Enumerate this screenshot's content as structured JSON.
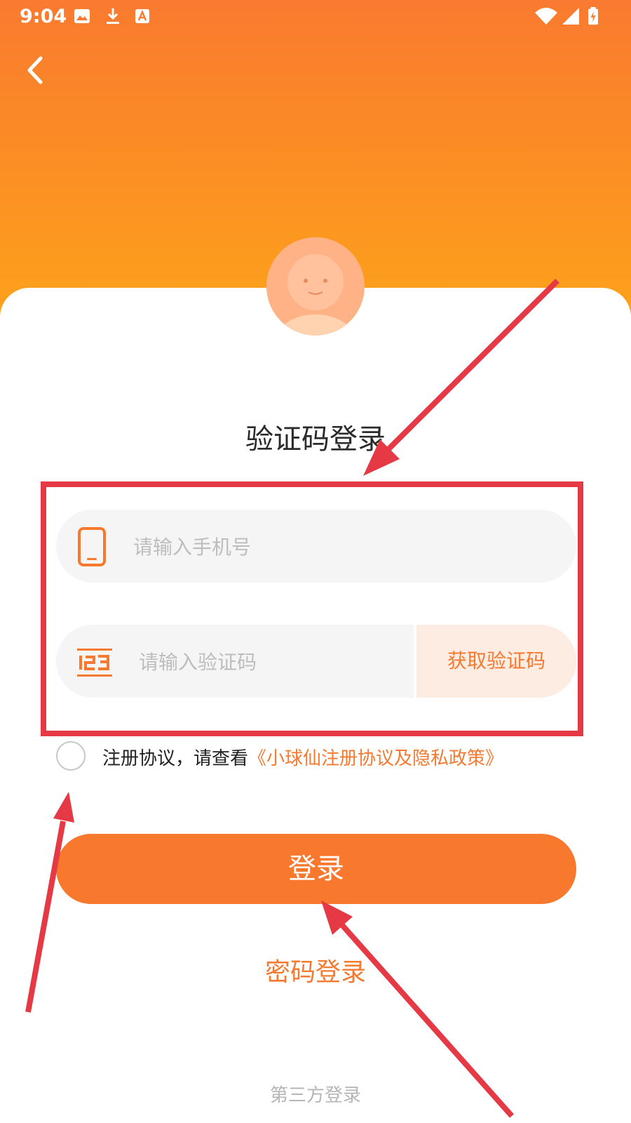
{
  "status_bar": {
    "time": "9:04",
    "icons": [
      "image-icon",
      "download-icon",
      "font-icon",
      "wifi-icon",
      "signal-icon",
      "battery-charging-icon"
    ]
  },
  "header": {
    "back_icon": "chevron-left-icon"
  },
  "avatar": {
    "icon": "avatar-face"
  },
  "form": {
    "title": "验证码登录",
    "phone": {
      "placeholder": "请输入手机号",
      "value": "",
      "icon": "phone-icon"
    },
    "code": {
      "placeholder": "请输入验证码",
      "value": "",
      "icon": "code-123-icon",
      "get_code_label": "获取验证码"
    }
  },
  "agreement": {
    "checked": false,
    "text": "注册协议，请查看",
    "link": "《小球仙注册协议及隐私政策》"
  },
  "actions": {
    "login_label": "登录",
    "password_login_label": "密码登录",
    "third_party_label": "第三方登录"
  },
  "colors": {
    "accent": "#f8792e",
    "header_top": "#f97a30",
    "header_bottom": "#fda21b",
    "annotation": "#e53945"
  }
}
